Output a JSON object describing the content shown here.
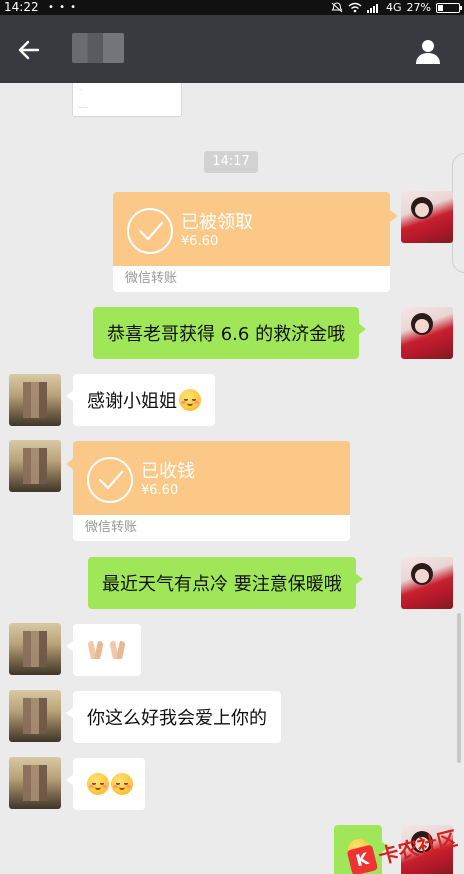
{
  "status_bar": {
    "time": "14:22",
    "dots": "• • •",
    "network": "4G",
    "battery": "27%",
    "battery_level": 0.27
  },
  "header": {
    "back_icon": "arrow-left-icon",
    "profile_icon": "person-icon"
  },
  "chat": {
    "image_message": {
      "line1": "···",
      "line2": "··· ···"
    },
    "timestamp": "14:17",
    "messages": {
      "transfer1": {
        "title": "已被领取",
        "amount": "¥6.60",
        "footer": "微信转账"
      },
      "m1": "恭喜老哥获得 6.6 的救济金哦",
      "m2": "感谢小姐姐",
      "transfer2": {
        "title": "已收钱",
        "amount": "¥6.60",
        "footer": "微信转账"
      },
      "m3": "最近天气有点冷 要注意保暖哦",
      "m4_icons": [
        "pray-hands-emoji",
        "pray-hands-emoji"
      ],
      "m5": "你这么好我会爱上你的",
      "m6_icons": [
        "blush-emoji",
        "blush-emoji"
      ],
      "m7_icons": [
        "blush-emoji"
      ]
    }
  },
  "watermark": {
    "logo": "K",
    "text": "卡农社区"
  },
  "colors": {
    "header_bg": "#393a3f",
    "chat_bg": "#ebebeb",
    "bubble_green": "#9fe658",
    "transfer_orange": "#fbc888"
  }
}
